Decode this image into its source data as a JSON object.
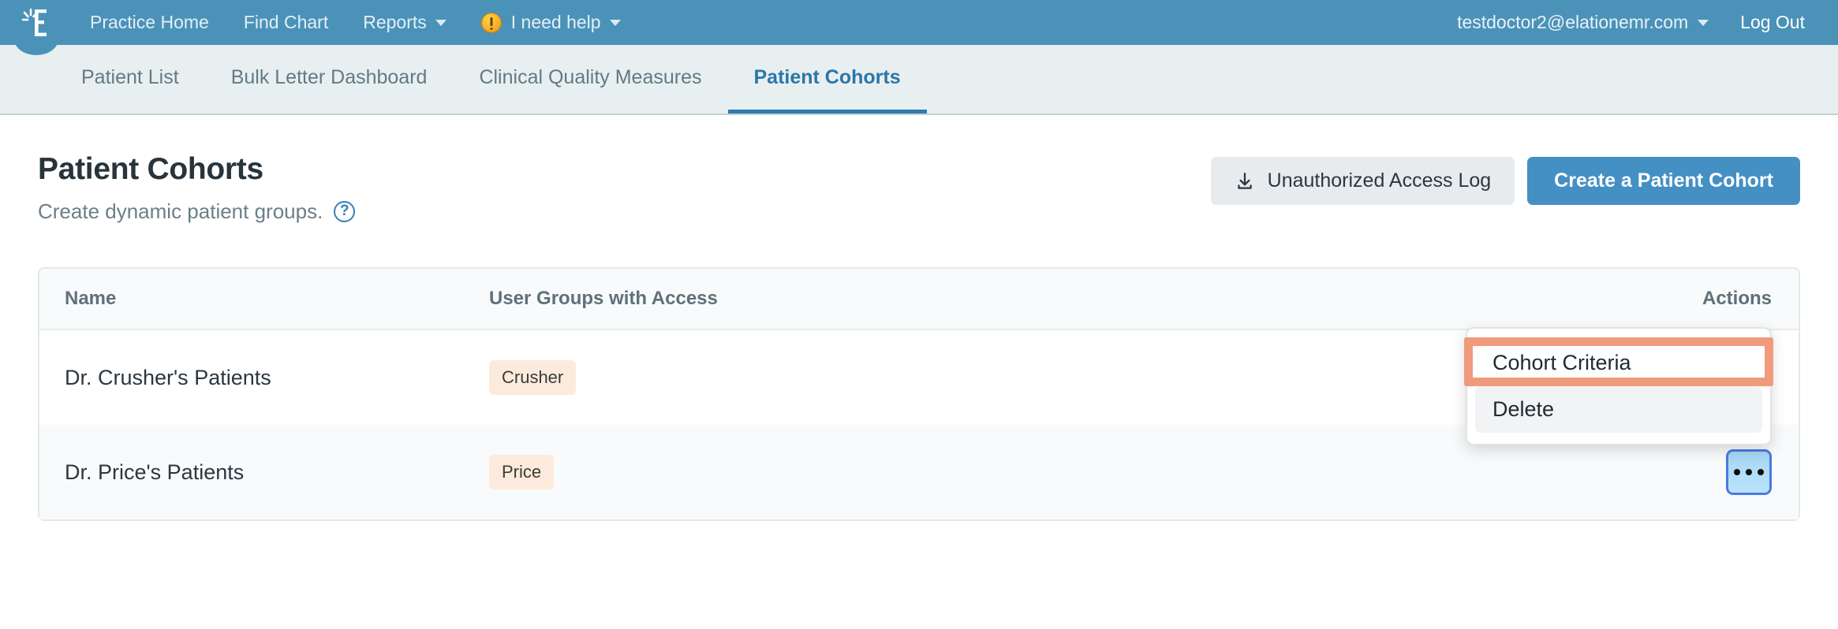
{
  "topbar": {
    "logo_name": "elation-logo",
    "nav": [
      {
        "label": "Practice Home",
        "caret": false
      },
      {
        "label": "Find Chart",
        "caret": false
      },
      {
        "label": "Reports",
        "caret": true
      }
    ],
    "help": {
      "label": "I need help",
      "icon": "warning-icon"
    },
    "account": "testdoctor2@elationemr.com",
    "logout": "Log Out",
    "bg_color": "#4b92b9"
  },
  "subnav": {
    "items": [
      {
        "label": "Patient List",
        "active": false
      },
      {
        "label": "Bulk Letter Dashboard",
        "active": false
      },
      {
        "label": "Clinical Quality Measures",
        "active": false
      },
      {
        "label": "Patient Cohorts",
        "active": true
      }
    ],
    "active_color": "#2d7cad"
  },
  "page": {
    "title": "Patient Cohorts",
    "subtitle": "Create dynamic patient groups.",
    "help_glyph": "?",
    "secondary_button": "Unauthorized Access Log",
    "primary_button": "Create a Patient Cohort",
    "primary_color": "#4490c4"
  },
  "table": {
    "headers": {
      "name": "Name",
      "groups": "User Groups with Access",
      "actions": "Actions"
    },
    "rows": [
      {
        "name": "Dr. Crusher's Patients",
        "group": "Crusher"
      },
      {
        "name": "Dr. Price's Patients",
        "group": "Price"
      }
    ],
    "badge_color": "#fcebdc"
  },
  "dropdown": {
    "items": [
      {
        "label": "Cohort Criteria",
        "highlighted": true
      },
      {
        "label": "Delete",
        "highlighted": false
      }
    ],
    "highlight_color": "#ef9b7c"
  }
}
